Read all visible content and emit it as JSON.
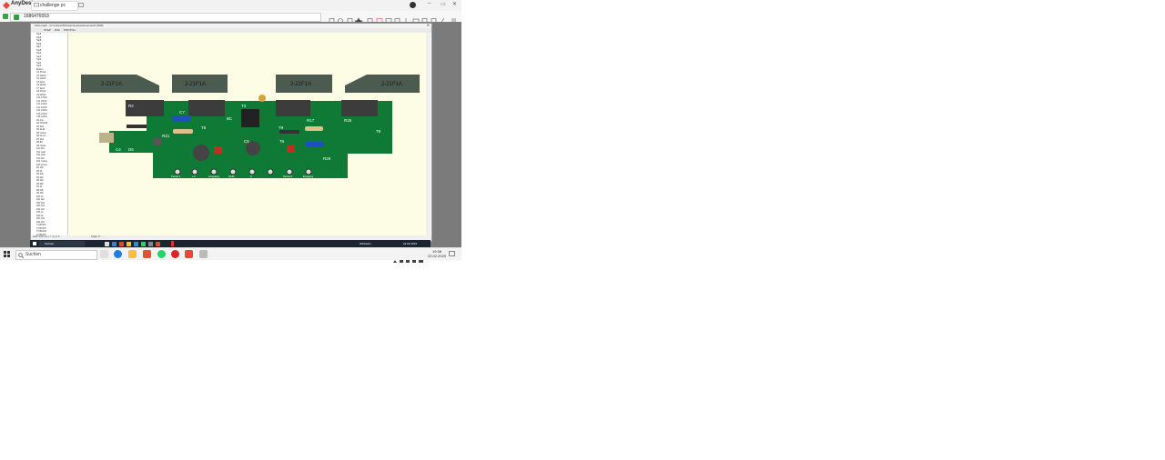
{
  "anydesk": {
    "brand": "AnyDesk",
    "tab_label": "challenge pc",
    "address": "1686476553",
    "accent": "#ef443b"
  },
  "remote": {
    "window_title": "Schematic - [C:\\Users\\Winbeam\\Lasswa\\Lasswahl 1980]",
    "menu": [
      "STEP",
      "DXF",
      "PDF/Print"
    ],
    "status_left": "GAP: 100 mm | Y: 4 | Z: 0",
    "status_mid": "Angle: 0° · ...",
    "tree_items": [
      "Tap5",
      "Tap9",
      "Tap8",
      "Tap6",
      "Tap7",
      "Tap5",
      "Tap3",
      "Tap4",
      "Tap4",
      "Tap3",
      "Tap4",
      "Bottom",
      "C1 470uF",
      "C3 100uF",
      "C4 100uF",
      "C5 22uF",
      "C6 220pF",
      "C7 22uF",
      "C8 470uF",
      "C9 220uF",
      "C10 470uF",
      "C11 100nF",
      "C12 100nF",
      "C13 100nF",
      "C14 100nF",
      "C15 100nF",
      "C16 100nF",
      "D1 Fox",
      "D2 1N4148",
      "D3 Red",
      "D4 4148",
      "D5 Yellow",
      "D6 Green",
      "D7 Red",
      "D8 BC",
      "D9 Yellow",
      "D10 Rot",
      "D11 Gelb",
      "D12 LED",
      "D13 Rot",
      "D14 Yellow",
      "D15 Green",
      "R1 10k",
      "R2 1k",
      "R3 10k",
      "R4 22k",
      "R5 10k",
      "R6 22k",
      "R7 1k",
      "R8 10k",
      "R9 10k",
      "R10 1k",
      "R11 2k2",
      "R12 2k2",
      "R13 10k",
      "R14 2k2",
      "R15 1k",
      "R16 1k",
      "R17 22k",
      "R18 2k2",
      "T1 BC547",
      "T2 BC547",
      "T3 BD139",
      "T4 BC557",
      "T5 2SC2073",
      "T6 2SA940",
      "T7 2SC3856",
      "T8 2SA1492",
      "T9 IRF540",
      "T10 IRF9540"
    ],
    "pcb_labels": {
      "heatsink": "2-21F1A",
      "components": [
        "R2",
        "R1",
        "R17",
        "R25",
        "C4",
        "D6",
        "C5",
        "C7",
        "R21",
        "T5",
        "T9",
        "T8",
        "T3",
        "T6",
        "R29",
        "BC"
      ],
      "connectors": [
        "Kanal 1",
        "+V",
        "Ausgang",
        "GND",
        "-V",
        "Kanal 2",
        "Eingang"
      ]
    },
    "taskbar_search": "Suchen",
    "tray_date_small": "22.02.2023",
    "tray_user": "Winbeam"
  },
  "local_taskbar": {
    "search": "Suchen",
    "time": "19:38",
    "date": "22.02.2023"
  },
  "colors": {
    "pcb": "#0f7a35",
    "heatsink": "#4b5b50",
    "canvas": "#fdfce5"
  }
}
